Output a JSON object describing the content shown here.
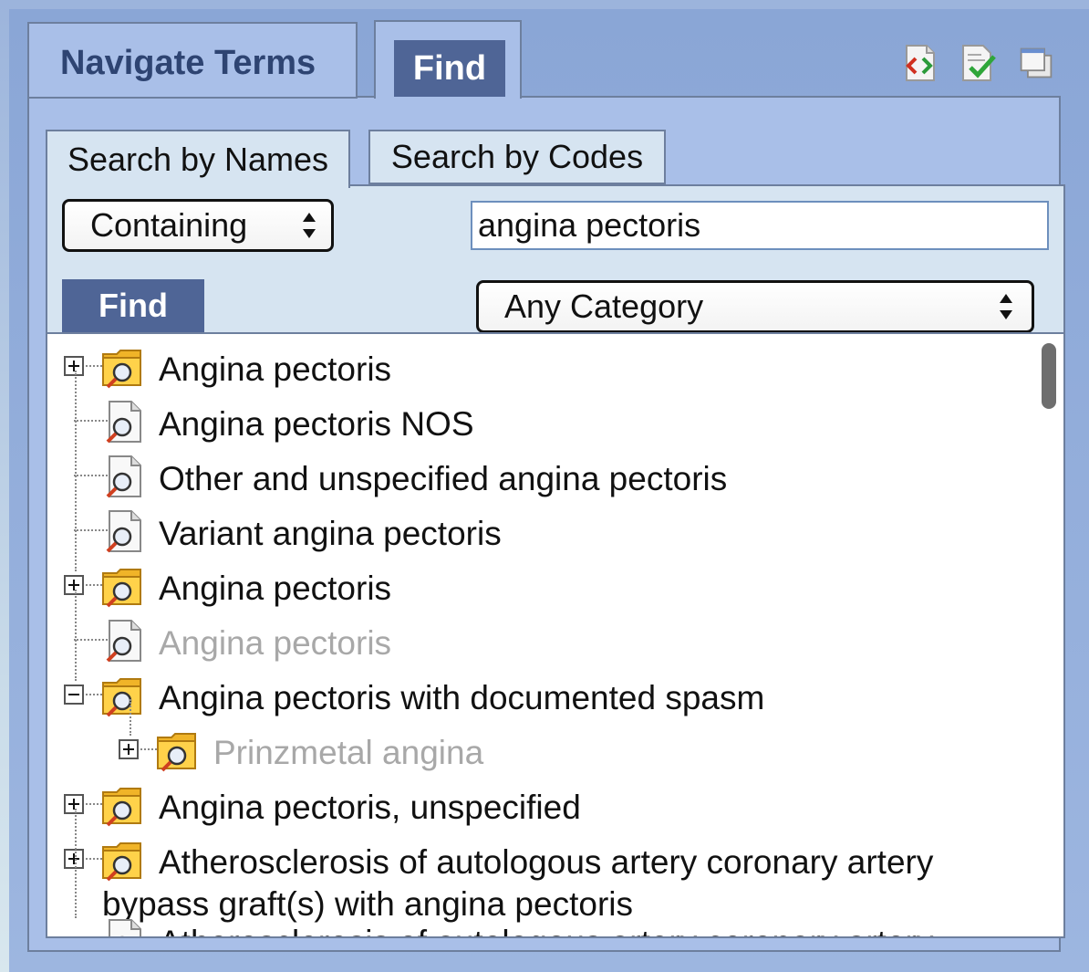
{
  "tabs": {
    "navigate_label": "Navigate Terms",
    "find_label": "Find"
  },
  "toolbar_icons": [
    "code-icon",
    "checked-document-icon",
    "windows-icon"
  ],
  "subtabs": {
    "names_label": "Search by Names",
    "codes_label": "Search by Codes"
  },
  "search": {
    "mode_value": "Containing",
    "query_value": "angina pectoris",
    "find_label": "Find",
    "category_value": "Any Category"
  },
  "tree": {
    "items": [
      {
        "label": "Angina pectoris",
        "type": "folder",
        "expander": "plus",
        "enabled": true
      },
      {
        "label": "Angina pectoris NOS",
        "type": "document",
        "expander": "none",
        "enabled": true
      },
      {
        "label": "Other and unspecified angina pectoris",
        "type": "document",
        "expander": "none",
        "enabled": true
      },
      {
        "label": "Variant angina pectoris",
        "type": "document",
        "expander": "none",
        "enabled": true
      },
      {
        "label": "Angina pectoris",
        "type": "folder",
        "expander": "plus",
        "enabled": true
      },
      {
        "label": "Angina pectoris",
        "type": "document",
        "expander": "none",
        "enabled": false
      },
      {
        "label": "Angina pectoris with documented spasm",
        "type": "folder",
        "expander": "minus",
        "enabled": true
      },
      {
        "label": "Prinzmetal angina",
        "type": "folder",
        "expander": "plus",
        "enabled": false
      },
      {
        "label": "Angina pectoris, unspecified",
        "type": "folder",
        "expander": "plus",
        "enabled": true
      },
      {
        "label_line1": "Atherosclerosis of autologous artery coronary artery",
        "label_line2": "bypass graft(s) with angina pectoris",
        "type": "folder",
        "expander": "plus",
        "enabled": true
      },
      {
        "label": "Atherosclerosis of autologous artery coronary artery",
        "type": "document",
        "expander": "none",
        "enabled": true
      }
    ]
  },
  "colors": {
    "active_tab": "#4f6596",
    "tab_text": "#2e4472",
    "frame_bg": "#a9bfe8",
    "inner_bg": "#d6e4f1"
  }
}
